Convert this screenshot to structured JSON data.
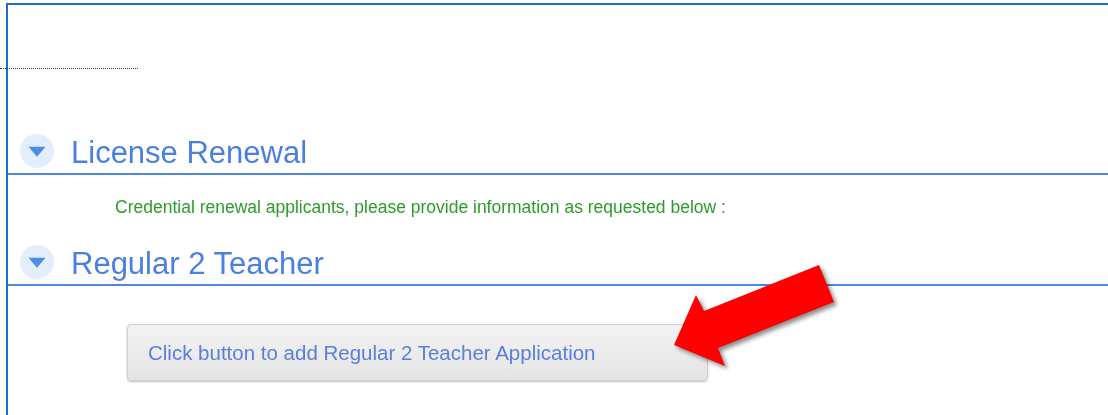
{
  "sections": [
    {
      "title": "License Renewal",
      "expanded": true,
      "content": [
        {
          "kind": "note",
          "text": "Credential renewal applicants, please provide information as requested below :"
        }
      ]
    },
    {
      "title": "Regular 2 Teacher",
      "expanded": true,
      "content": [
        {
          "kind": "button",
          "text": "Click button to add Regular 2 Teacher Application"
        }
      ]
    }
  ]
}
